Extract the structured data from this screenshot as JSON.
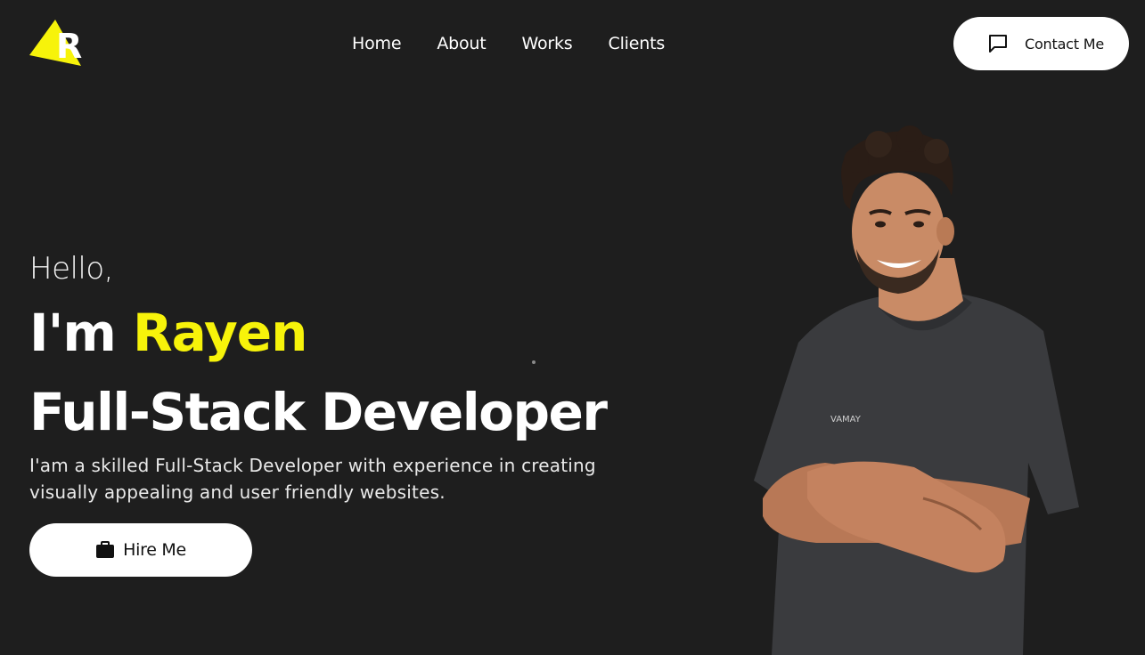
{
  "brand": {
    "logo_letter": "R",
    "logo_color": "#f7f30a"
  },
  "nav": {
    "items": [
      {
        "label": "Home"
      },
      {
        "label": "About"
      },
      {
        "label": "Works"
      },
      {
        "label": "Clients"
      }
    ]
  },
  "header": {
    "contact_label": "Contact Me",
    "contact_icon": "message-square-icon"
  },
  "hero": {
    "greeting": "Hello,",
    "name_prefix": "I'm ",
    "name": "Rayen",
    "role": "Full-Stack Developer",
    "description": "I'am a skilled Full-Stack Developer with experience in creating visually appealing and user friendly websites.",
    "hire_label": "Hire Me",
    "hire_icon": "briefcase-icon",
    "shirt_text": "VAMAY"
  },
  "colors": {
    "background": "#1e1e1e",
    "accent": "#f7f30a",
    "button_bg": "#ffffff",
    "button_text": "#111111"
  }
}
